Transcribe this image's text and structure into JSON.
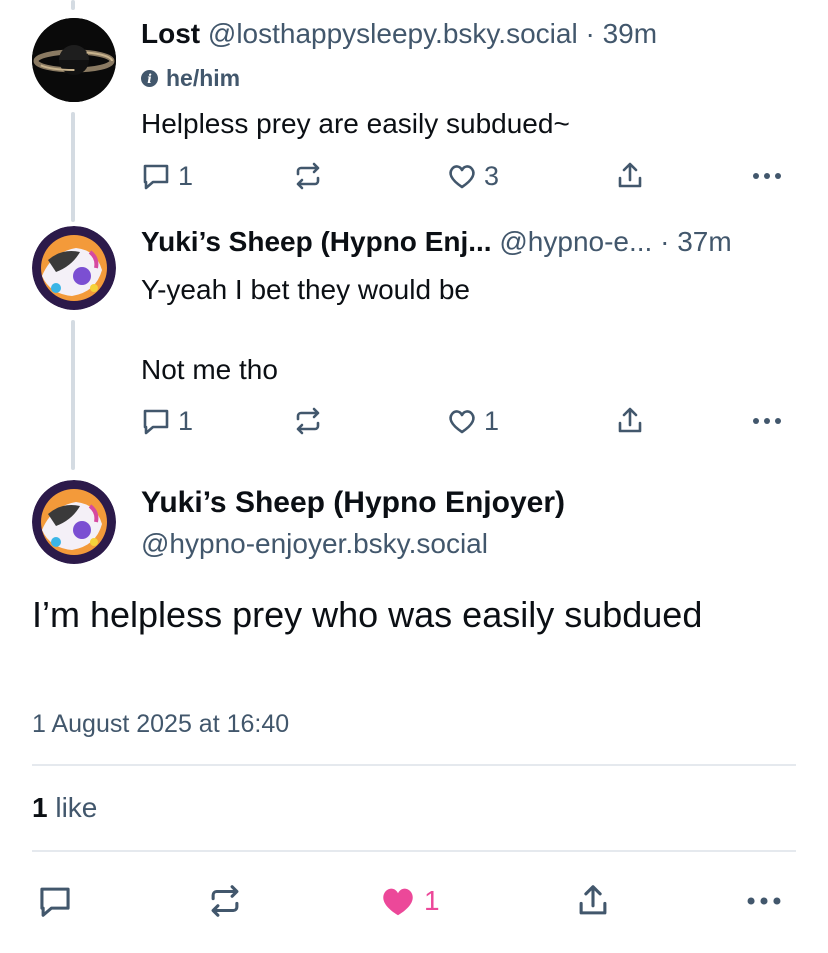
{
  "post1": {
    "display_name": "Lost",
    "handle": "@losthappysleepy.bsky.social",
    "time": "· 39m",
    "pronouns": "he/him",
    "text": "Helpless prey are easily subdued~",
    "reply_count": "1",
    "like_count": "3"
  },
  "post2": {
    "display_name": "Yuki’s Sheep (Hypno Enj...",
    "handle": "@hypno-e...",
    "time": "· 37m",
    "text_line1": "Y-yeah I bet they would be",
    "text_line2": "Not me tho",
    "reply_count": "1",
    "like_count": "1"
  },
  "main": {
    "display_name": "Yuki’s Sheep (Hypno Enjoyer)",
    "handle": "@hypno-enjoyer.bsky.social",
    "text": "I’m helpless prey who was easily subdued",
    "timestamp": "1 August 2025 at 16:40",
    "like_count": "1",
    "like_word": "like",
    "liked_count": "1"
  },
  "colors": {
    "muted": "#42576c",
    "like_active": "#ec4899",
    "thread_line": "#d4dbe2"
  },
  "icons": [
    "reply-icon",
    "repost-icon",
    "like-icon",
    "share-icon",
    "more-icon",
    "info-icon"
  ]
}
